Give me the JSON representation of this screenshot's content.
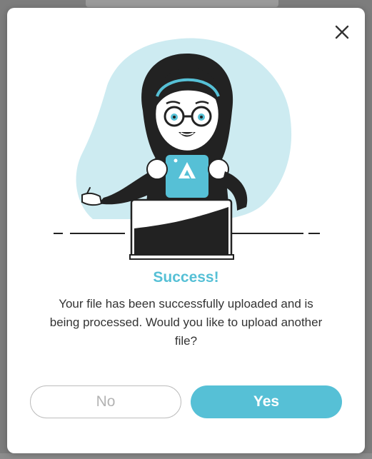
{
  "dialog": {
    "title": "Success!",
    "message": "Your file has been successfully uploaded and is being processed. Would you like to upload another file?",
    "no_label": "No",
    "yes_label": "Yes",
    "close_icon": "close-icon"
  },
  "colors": {
    "accent": "#56c0d6",
    "blob": "#cdebf1",
    "ink": "#222222",
    "text": "#333333"
  }
}
